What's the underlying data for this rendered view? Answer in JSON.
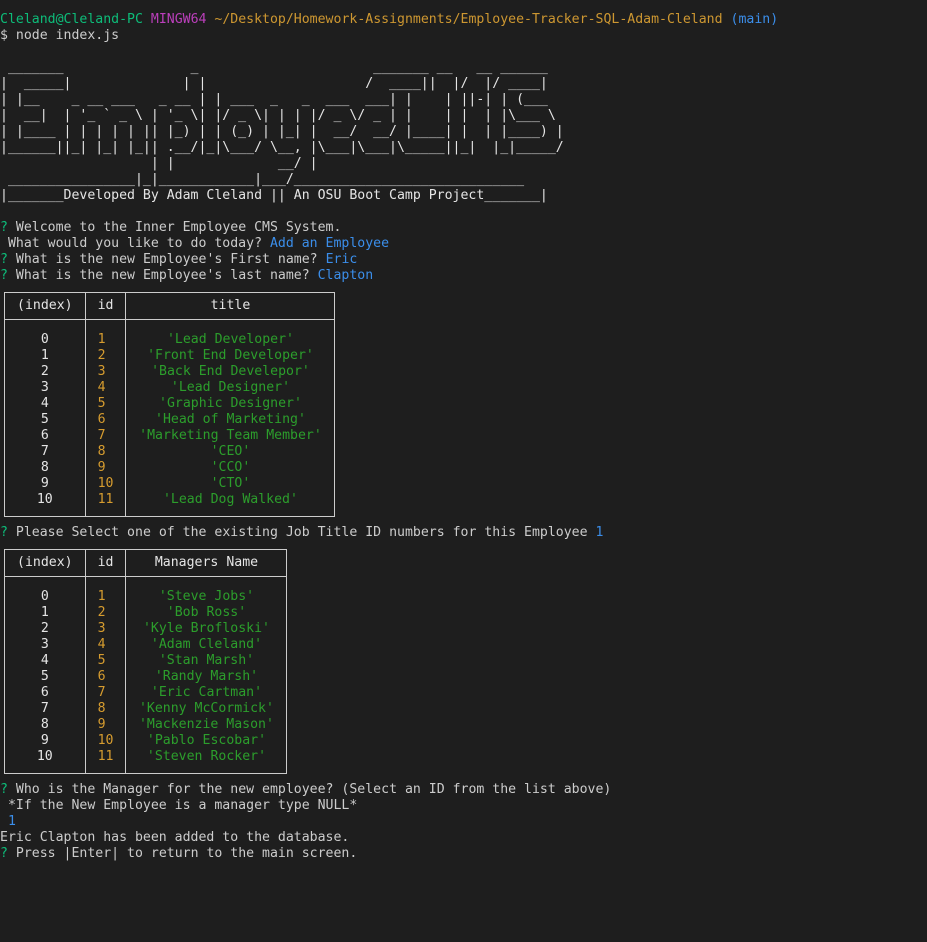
{
  "prompt": {
    "user_host": "Cleland@Cleland-PC",
    "env": "MINGW64",
    "path": "~/Desktop/Homework-Assignments/Employee-Tracker-SQL-Adam-Cleland",
    "branch": "(main)",
    "command": "$ node index.js"
  },
  "banner_ascii": " _______                _                      _______ __   __ ______\n|  _____|              | |                    /  ____||  |/  |/ ____|\n| |__    _ __ ___   _ __ | | ___  _   _  ___  ___| |    | ||-| | (___\n|  __|  | '_ ` _ \\ | '_ \\| |/ _ \\| | | |/ _ \\/ _ | |    | |  | |\\___ \\\n| |____ | | | | | || |_) | | (_) | |_| |  __/  __/ |____| |  | |____) |\n|______||_| |_| |_|| .__/|_|\\___/ \\__, |\\___|\\___|\\_____||_|  |_|_____/\n                   | |             __/ |\n ________________|_|____________|___/_____________________________\n|_______Developed By Adam Cleland || An OSU Boot Camp Project_______|",
  "session": {
    "welcome": "Welcome to the Inner Employee CMS System.",
    "q_action": " What would you like to do today? ",
    "a_action": "Add an Employee",
    "q_first": "What is the new Employee's First name? ",
    "a_first": "Eric",
    "q_last": "What is the new Employee's last name? ",
    "a_last": "Clapton",
    "q_title": "Please Select one of the existing Job Title ID numbers for this Employee ",
    "a_title": "1",
    "q_manager": "Who is the Manager for the new employee? (Select an ID from the list above)",
    "q_manager_note": " *If the New Employee is a manager type NULL*",
    "a_manager": " 1",
    "result": "Eric Clapton has been added to the database.",
    "q_enter": "Press |Enter| to return to the main screen."
  },
  "titles_table": {
    "headers": [
      "(index)",
      "id",
      "title"
    ],
    "rows": [
      [
        "0",
        "1",
        "'Lead Developer'"
      ],
      [
        "1",
        "2",
        "'Front End Developer'"
      ],
      [
        "2",
        "3",
        "'Back End Develepor'"
      ],
      [
        "3",
        "4",
        "'Lead Designer'"
      ],
      [
        "4",
        "5",
        "'Graphic Designer'"
      ],
      [
        "5",
        "6",
        "'Head of Marketing'"
      ],
      [
        "6",
        "7",
        "'Marketing Team Member'"
      ],
      [
        "7",
        "8",
        "'CEO'"
      ],
      [
        "8",
        "9",
        "'CCO'"
      ],
      [
        "9",
        "10",
        "'CTO'"
      ],
      [
        "10",
        "11",
        "'Lead Dog Walked'"
      ]
    ]
  },
  "managers_table": {
    "headers": [
      "(index)",
      "id",
      "Managers Name"
    ],
    "rows": [
      [
        "0",
        "1",
        "'Steve Jobs'"
      ],
      [
        "1",
        "2",
        "'Bob Ross'"
      ],
      [
        "2",
        "3",
        "'Kyle Brofloski'"
      ],
      [
        "3",
        "4",
        "'Adam Cleland'"
      ],
      [
        "4",
        "5",
        "'Stan Marsh'"
      ],
      [
        "5",
        "6",
        "'Randy Marsh'"
      ],
      [
        "6",
        "7",
        "'Eric Cartman'"
      ],
      [
        "7",
        "8",
        "'Kenny McCormick'"
      ],
      [
        "8",
        "9",
        "'Mackenzie Mason'"
      ],
      [
        "9",
        "10",
        "'Pablo Escobar'"
      ],
      [
        "10",
        "11",
        "'Steven Rocker'"
      ]
    ]
  },
  "colors": {
    "background": "#1e1e1e",
    "prompt_user": "#23d18b",
    "prompt_env": "#bc3fbc",
    "prompt_path": "#cd9731",
    "prompt_branch": "#3b8eea",
    "answer": "#3b8eea",
    "string_value": "#2c9e2c",
    "number_value": "#d69c2f"
  }
}
